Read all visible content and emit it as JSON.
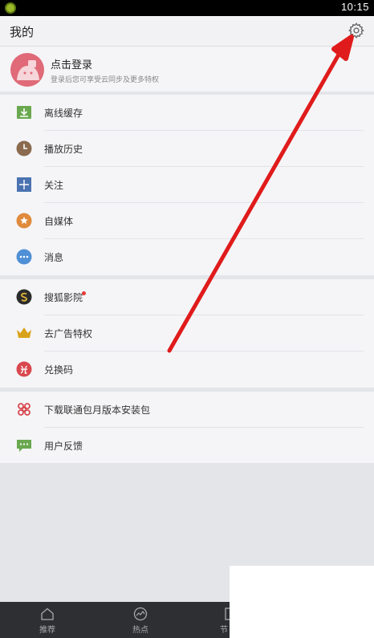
{
  "status_bar": {
    "time": "10:15",
    "app_icon": "app-logo-icon"
  },
  "header": {
    "title": "我的",
    "settings_icon": "gear-icon"
  },
  "user": {
    "login_title": "点击登录",
    "login_subtitle": "登录后您可享受云同步及更多特权",
    "avatar_icon": "avatar-icon"
  },
  "menu_group_1": [
    {
      "label": "离线缓存",
      "icon": "download-icon",
      "color": "#6aa84f"
    },
    {
      "label": "播放历史",
      "icon": "clock-icon",
      "color": "#8b6a4f"
    },
    {
      "label": "关注",
      "icon": "plus-icon",
      "color": "#4a72b0"
    },
    {
      "label": "自媒体",
      "icon": "star-icon",
      "color": "#e08a3c"
    },
    {
      "label": "消息",
      "icon": "message-dots-icon",
      "color": "#4f8fd6"
    }
  ],
  "menu_group_2": [
    {
      "label": "搜狐影院",
      "icon": "cinema-icon",
      "color": "#2b2b2b"
    },
    {
      "label": "去广告特权",
      "icon": "crown-icon",
      "color": "#d9a21b"
    },
    {
      "label": "兑换码",
      "icon": "redeem-icon",
      "color": "#d9484f"
    }
  ],
  "menu_group_3": [
    {
      "label": "下载联通包月版本安装包",
      "icon": "unicom-knot-icon",
      "color": "#d9484f"
    },
    {
      "label": "用户反馈",
      "icon": "feedback-icon",
      "color": "#6aa84f"
    }
  ],
  "bottom_nav": [
    {
      "label": "推荐",
      "icon": "home-icon"
    },
    {
      "label": "热点",
      "icon": "hot-icon"
    },
    {
      "label": "节",
      "icon": "partial-tab-icon"
    }
  ],
  "annotation": {
    "arrow_color": "#e01b1b"
  }
}
